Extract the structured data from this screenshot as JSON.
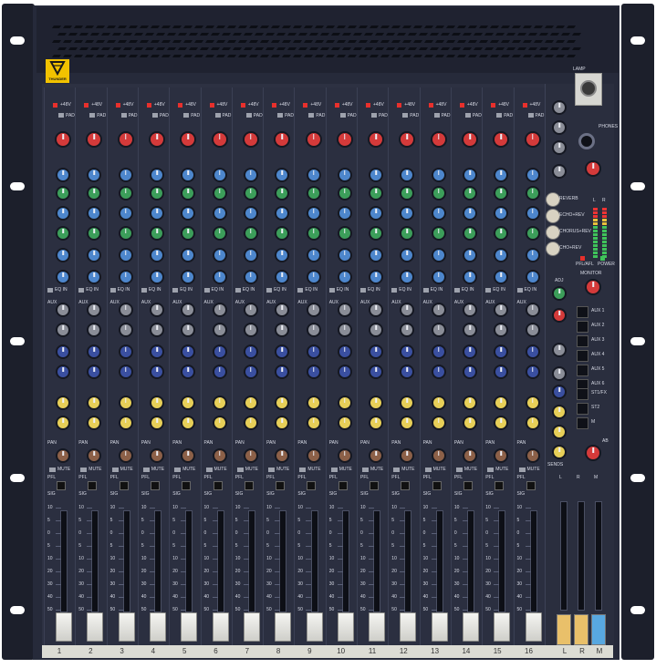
{
  "brand": {
    "logo_text": "THUNDER"
  },
  "channels": [
    "1",
    "2",
    "3",
    "4",
    "5",
    "6",
    "7",
    "8",
    "9",
    "10",
    "11",
    "12",
    "13",
    "14",
    "15",
    "16"
  ],
  "channel_labels": {
    "phantom": "+48V",
    "pad": "PAD",
    "eq": "EQ IN",
    "aux": "AUX",
    "pan": "PAN",
    "mute": "MUTE",
    "pfl": "PFL",
    "sig": "SIG"
  },
  "fader_scale": [
    "10",
    "5",
    "0",
    "5",
    "10",
    "20",
    "30",
    "40",
    "50"
  ],
  "master_labels": {
    "lamp": "LAMP",
    "phones": "PHONES",
    "meter_left": "L",
    "meter_right": "R",
    "pfl_afl": "PFL/AFL",
    "power": "POWER",
    "monitor": "MONITOR",
    "adj": "ADJ",
    "sends": "SENDS",
    "aux_buses": [
      "AUX 1",
      "AUX 2",
      "AUX 3",
      "AUX 4",
      "AUX 5",
      "AUX 6"
    ],
    "st_fx": "ST1/FX",
    "st2": "ST2",
    "m": "M",
    "ab": "AB",
    "fx_buttons": [
      "REVERB",
      "ECHO+REV",
      "CHORUS+REV",
      "CHO+REV"
    ],
    "master_faders": [
      "L",
      "R",
      "M"
    ]
  },
  "colors": {
    "panel": "#2d3142",
    "knob_red": "#d43a3a",
    "knob_blue": "#4d86cc",
    "knob_green": "#3c9e5a",
    "knob_gray": "#8a8d97",
    "knob_navy": "#3a4fa0",
    "knob_yellow": "#e7cf58",
    "knob_brown": "#8c6048",
    "fader_white": "#efefea",
    "fader_yellow": "#e9c06a",
    "fader_blue": "#58a8e0",
    "logo_yellow": "#f2c200"
  }
}
